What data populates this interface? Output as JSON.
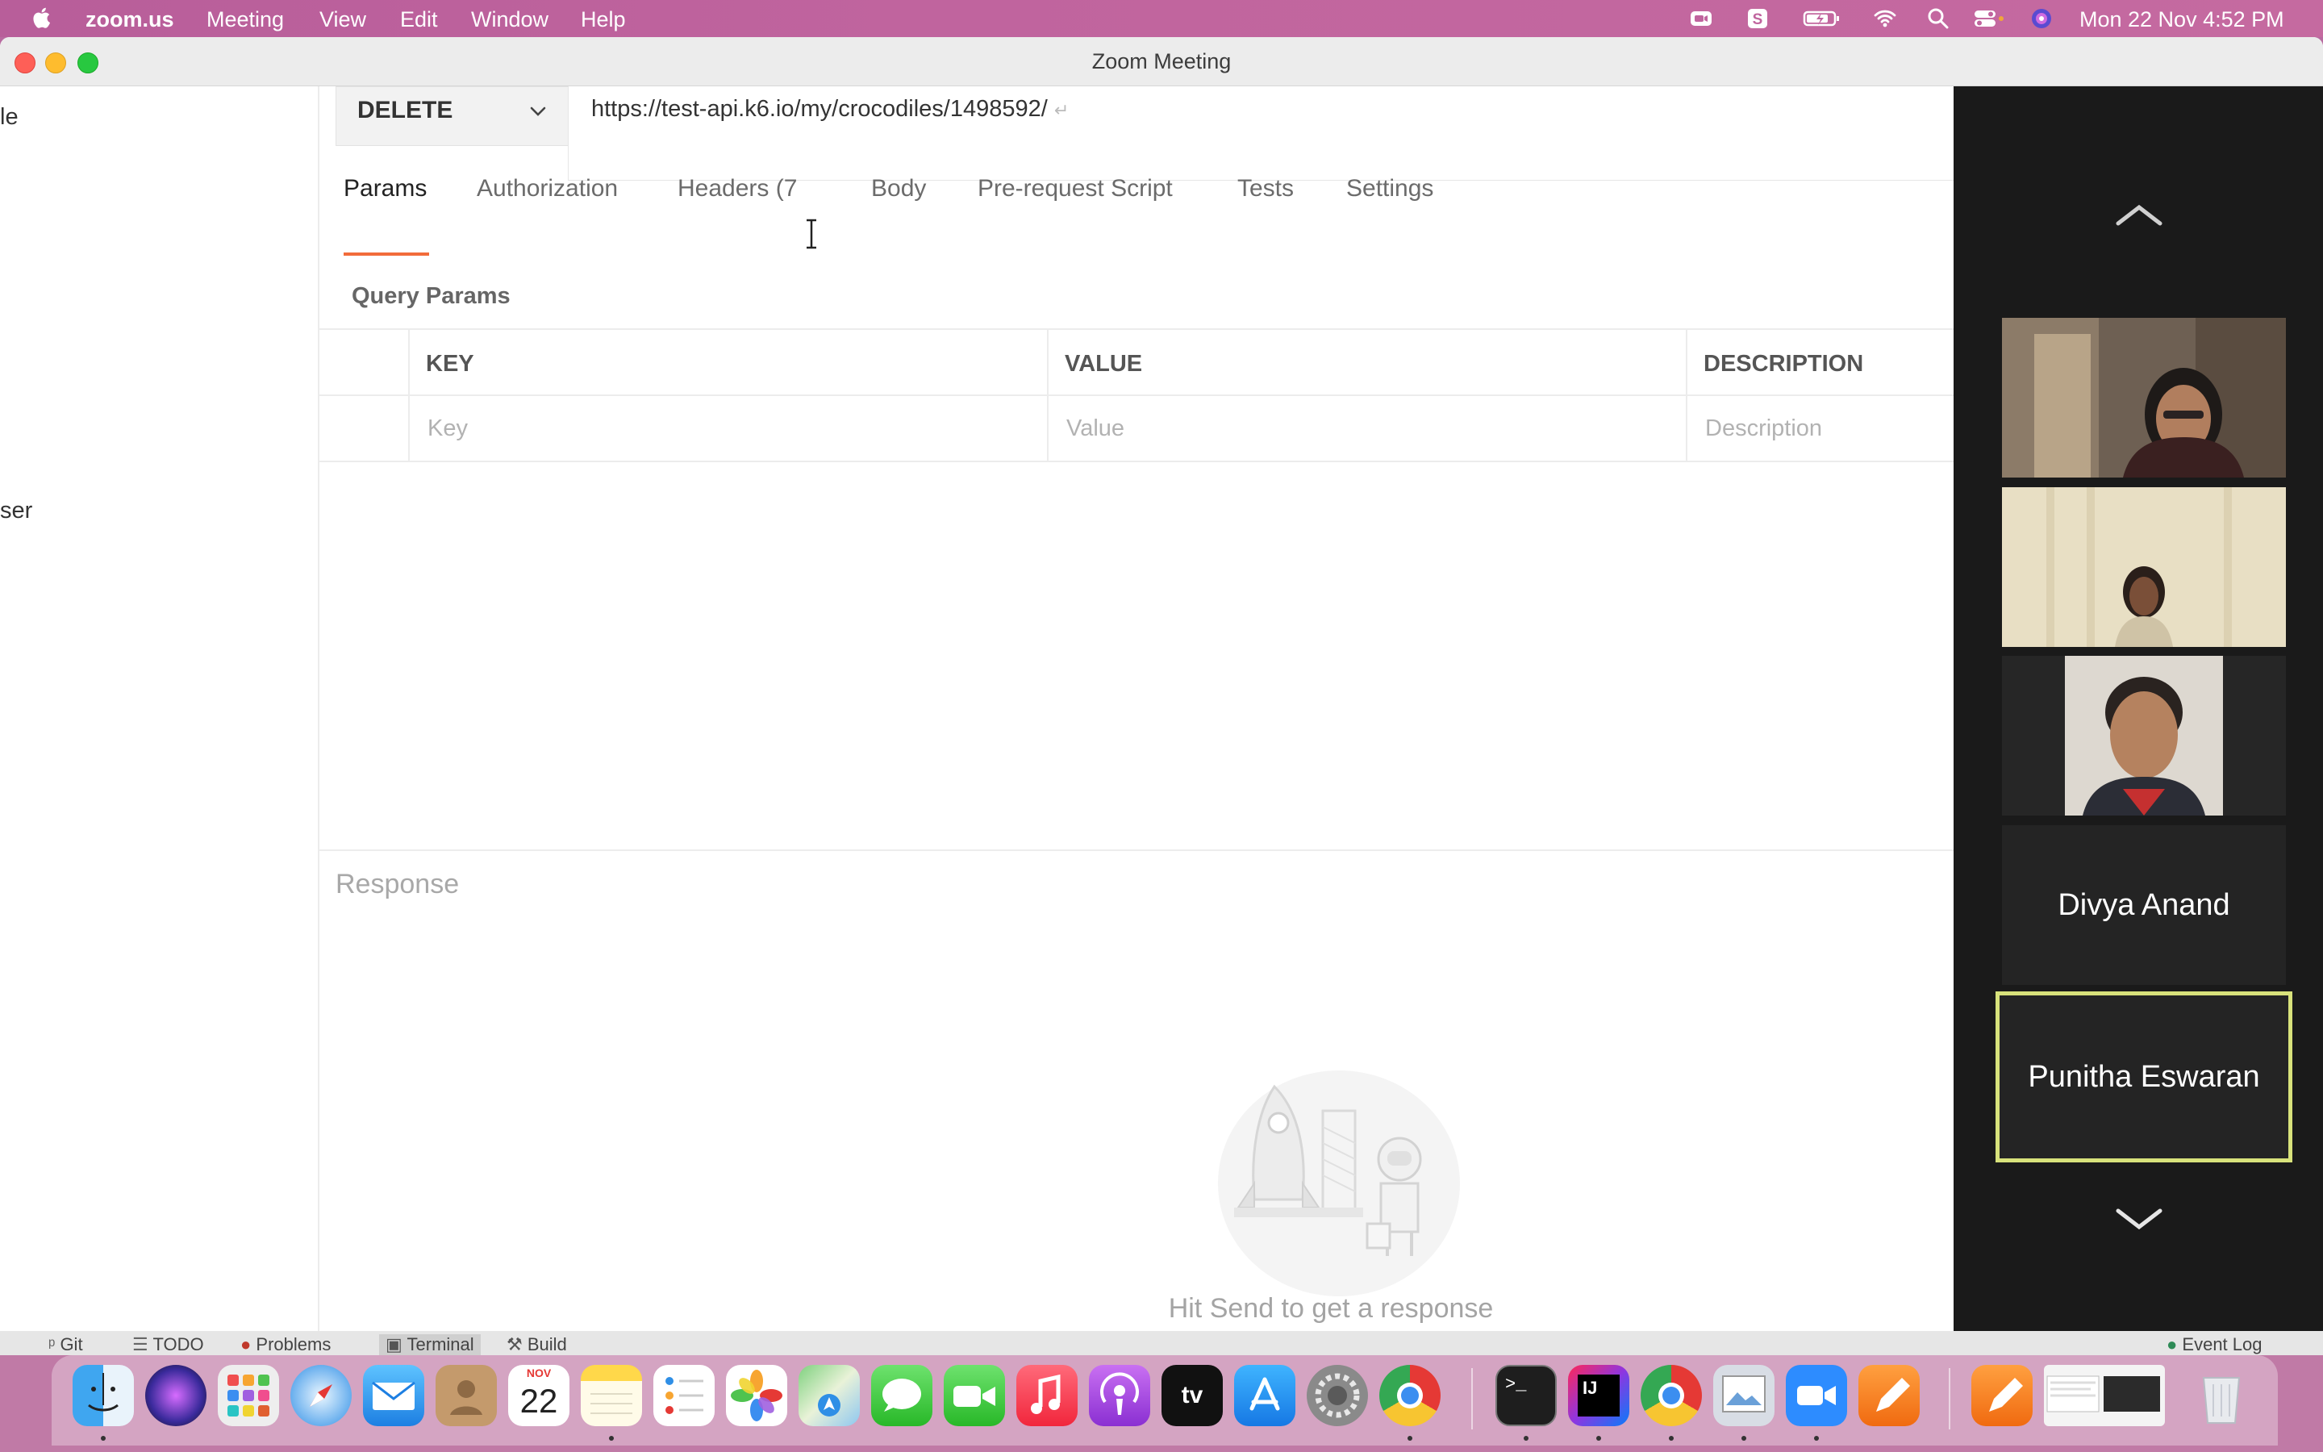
{
  "menubar": {
    "app_name": "zoom.us",
    "menus": [
      "Meeting",
      "View",
      "Edit",
      "Window",
      "Help"
    ],
    "clock": "Mon 22 Nov  4:52 PM"
  },
  "window": {
    "title": "Zoom Meeting"
  },
  "shared_screen": {
    "sidebar_fragments": [
      "le",
      "ser"
    ],
    "request": {
      "method": "DELETE",
      "url": "https://test-api.k6.io/my/crocodiles/1498592/",
      "url_suffix": "↵"
    },
    "tabs": [
      {
        "label": "Params",
        "active": true
      },
      {
        "label": "Authorization",
        "active": false
      },
      {
        "label": "Headers (7",
        "active": false
      },
      {
        "label": "Body",
        "active": false
      },
      {
        "label": "Pre-request Script",
        "active": false
      },
      {
        "label": "Tests",
        "active": false
      },
      {
        "label": "Settings",
        "active": false
      }
    ],
    "query_params": {
      "title": "Query Params",
      "columns": [
        "KEY",
        "VALUE",
        "DESCRIPTION"
      ],
      "placeholders": [
        "Key",
        "Value",
        "Description"
      ]
    },
    "response": {
      "label": "Response",
      "hint": "Hit Send to get a response"
    }
  },
  "participants": {
    "video_tiles": 3,
    "names": [
      "Divya Anand",
      "Punitha Eswaran"
    ],
    "active_speaker": "Punitha Eswaran",
    "active_border_color": "#d8e27b"
  },
  "ide_status_bar": {
    "items": [
      "Git",
      "TODO",
      "Problems",
      "Terminal",
      "Build"
    ],
    "right_item": "Event Log"
  },
  "dock": {
    "calendar_month": "NOV",
    "calendar_day": "22",
    "apps": [
      "Finder",
      "Siri",
      "Launchpad",
      "Safari",
      "Mail",
      "Contacts",
      "Calendar",
      "Notes",
      "Reminders",
      "Photos",
      "Maps",
      "Messages",
      "FaceTime",
      "Music",
      "Podcasts",
      "TV",
      "App Store",
      "System Preferences",
      "Chrome",
      "Terminal",
      "IntelliJ IDEA",
      "Chrome",
      "Preview",
      "Zoom",
      "Pages",
      "Pencil",
      "Windows",
      "Trash"
    ],
    "tv_label": "tv",
    "ij_label": "IJ"
  }
}
